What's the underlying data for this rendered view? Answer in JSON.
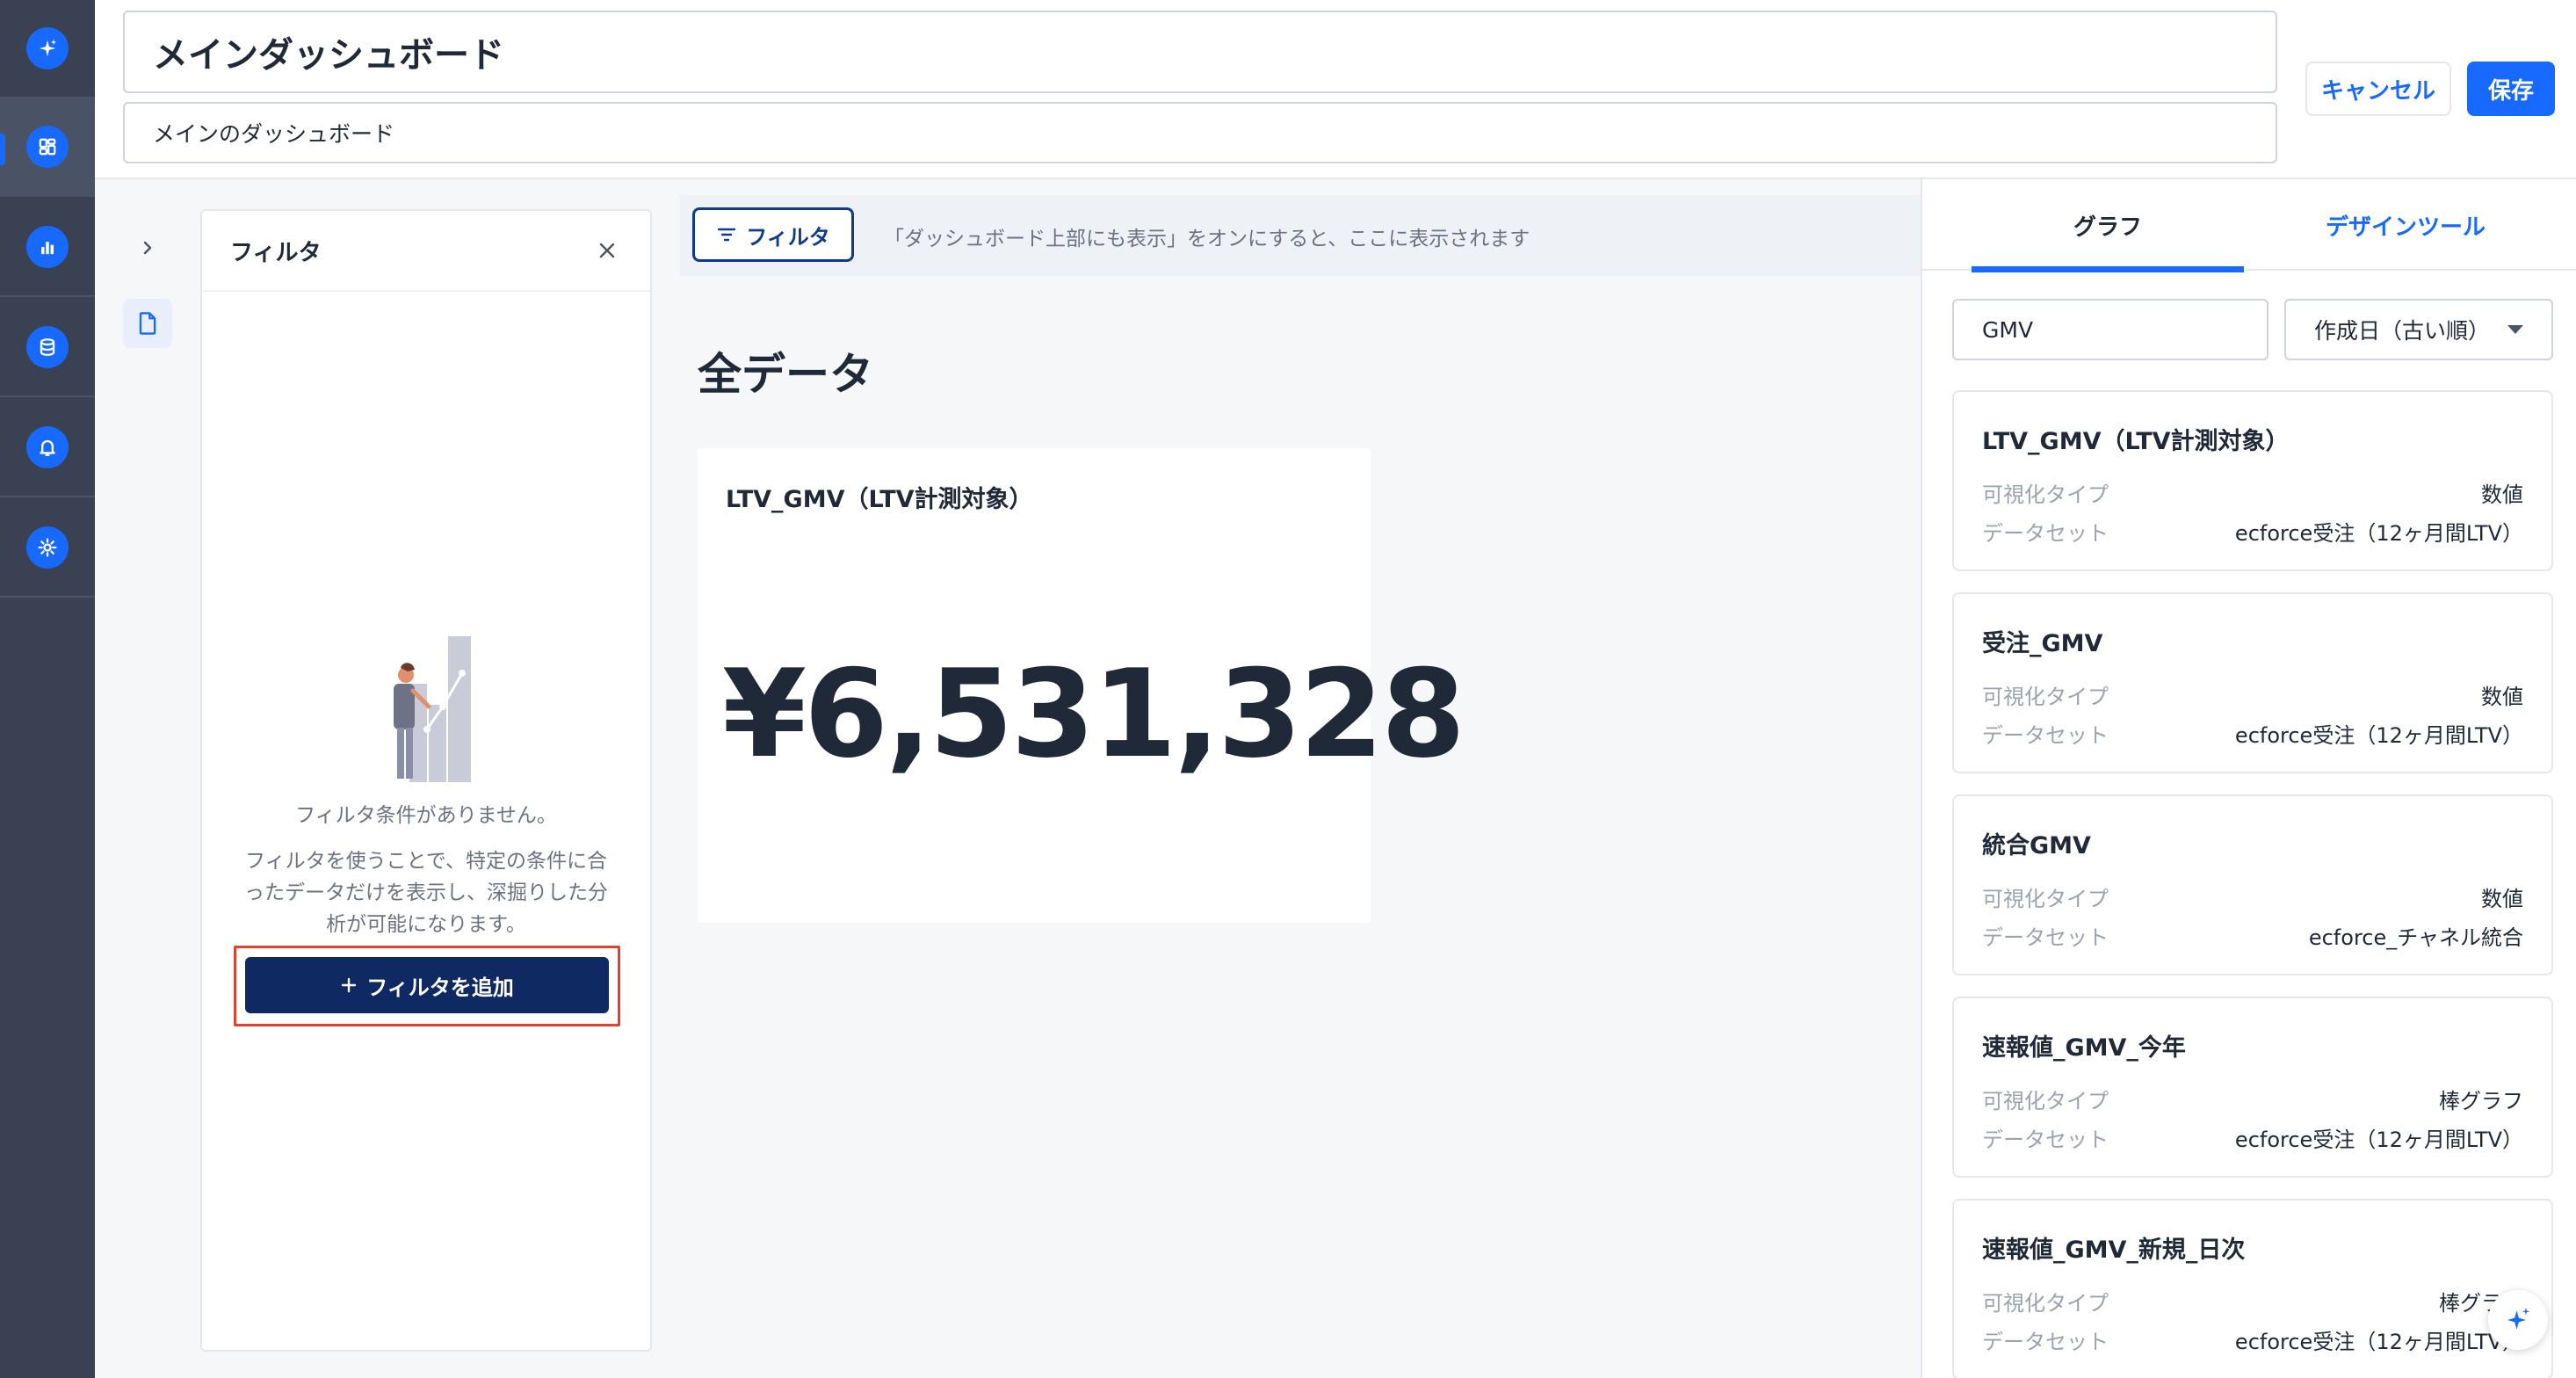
{
  "header": {
    "title": "メインダッシュボード",
    "description": "メインのダッシュボード",
    "cancel_label": "キャンセル",
    "save_label": "保存"
  },
  "nav": {
    "items": [
      {
        "icon": "sparkle-icon"
      },
      {
        "icon": "dashboard-icon",
        "active": true
      },
      {
        "icon": "bar-chart-icon"
      },
      {
        "icon": "database-icon"
      },
      {
        "icon": "bell-icon"
      },
      {
        "icon": "gear-icon"
      }
    ],
    "accent_color": "#1769ff"
  },
  "filter_panel": {
    "title": "フィルタ",
    "empty_title": "フィルタ条件がありません。",
    "empty_body": "フィルタを使うことで、特定の条件に合ったデータだけを表示し、深掘りした分析が可能になります。",
    "add_button": "フィルタを追加"
  },
  "canvas": {
    "filter_chip": "フィルタ",
    "filter_hint": "「ダッシュボード上部にも表示」をオンにすると、ここに表示されます",
    "section_title": "全データ",
    "kpi": {
      "title": "LTV_GMV（LTV計測対象）",
      "value": "¥6,531,328"
    }
  },
  "right_panel": {
    "tabs": [
      {
        "label": "グラフ",
        "active": true
      },
      {
        "label": "デザインツール",
        "active": false
      }
    ],
    "search_value": "GMV",
    "sort_value": "作成日（古い順）",
    "viz_type_label": "可視化タイプ",
    "dataset_label": "データセット",
    "cards": [
      {
        "title": "LTV_GMV（LTV計測対象）",
        "viz_type": "数値",
        "dataset": "ecforce受注（12ヶ月間LTV）"
      },
      {
        "title": "受注_GMV",
        "viz_type": "数値",
        "dataset": "ecforce受注（12ヶ月間LTV）"
      },
      {
        "title": "統合GMV",
        "viz_type": "数値",
        "dataset": "ecforce_チャネル統合"
      },
      {
        "title": "速報値_GMV_今年",
        "viz_type": "棒グラフ",
        "dataset": "ecforce受注（12ヶ月間LTV）"
      },
      {
        "title": "速報値_GMV_新規_日次",
        "viz_type": "棒グラフ",
        "dataset": "ecforce受注（12ヶ月間LTV）"
      }
    ]
  }
}
